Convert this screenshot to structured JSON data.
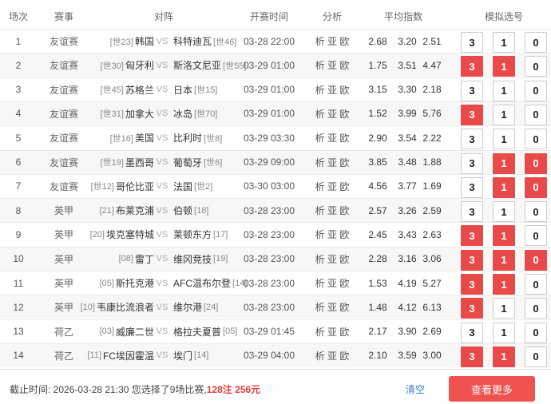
{
  "header": {
    "idx": "场次",
    "league": "赛事",
    "matchup": "对阵",
    "time": "开赛时间",
    "analysis": "分析",
    "avg_odds": "平均指数",
    "sim": "模拟选号"
  },
  "analysis_links": [
    "析",
    "亚",
    "欧"
  ],
  "vs": "VS",
  "rows": [
    {
      "idx": "1",
      "league": "友谊赛",
      "home_rank": "[世23]",
      "home": "韩国",
      "away": "科特迪瓦",
      "away_rank": "[世46]",
      "time": "03-28 22:00",
      "o1": "2.68",
      "o2": "3.20",
      "o3": "2.51",
      "sel": [
        false,
        false,
        false
      ]
    },
    {
      "idx": "2",
      "league": "友谊赛",
      "home_rank": "[世30]",
      "home": "匈牙利",
      "away": "斯洛文尼亚",
      "away_rank": "[世55]",
      "time": "03-29 01:00",
      "o1": "1.75",
      "o2": "3.51",
      "o3": "4.47",
      "sel": [
        true,
        true,
        false
      ]
    },
    {
      "idx": "3",
      "league": "友谊赛",
      "home_rank": "[世45]",
      "home": "苏格兰",
      "away": "日本",
      "away_rank": "[世15]",
      "time": "03-29 01:00",
      "o1": "3.15",
      "o2": "3.30",
      "o3": "2.18",
      "sel": [
        false,
        false,
        false
      ]
    },
    {
      "idx": "4",
      "league": "友谊赛",
      "home_rank": "[世31]",
      "home": "加拿大",
      "away": "冰岛",
      "away_rank": "[世70]",
      "time": "03-29 01:00",
      "o1": "1.52",
      "o2": "3.99",
      "o3": "5.76",
      "sel": [
        true,
        false,
        false
      ]
    },
    {
      "idx": "5",
      "league": "友谊赛",
      "home_rank": "[世16]",
      "home": "美国",
      "away": "比利时",
      "away_rank": "[世8]",
      "time": "03-29 03:30",
      "o1": "2.90",
      "o2": "3.54",
      "o3": "2.22",
      "sel": [
        false,
        false,
        false
      ]
    },
    {
      "idx": "6",
      "league": "友谊赛",
      "home_rank": "[世19]",
      "home": "墨西哥",
      "away": "葡萄牙",
      "away_rank": "[世6]",
      "time": "03-29 09:00",
      "o1": "3.85",
      "o2": "3.48",
      "o3": "1.88",
      "sel": [
        false,
        true,
        true
      ]
    },
    {
      "idx": "7",
      "league": "友谊赛",
      "home_rank": "[世12]",
      "home": "哥伦比亚",
      "away": "法国",
      "away_rank": "[世2]",
      "time": "03-30 03:00",
      "o1": "4.56",
      "o2": "3.77",
      "o3": "1.69",
      "sel": [
        false,
        true,
        true
      ]
    },
    {
      "idx": "8",
      "league": "英甲",
      "home_rank": "[21]",
      "home": "布莱克浦",
      "away": "伯顿",
      "away_rank": "[18]",
      "time": "03-28 23:00",
      "o1": "2.57",
      "o2": "3.26",
      "o3": "2.59",
      "sel": [
        false,
        false,
        false
      ]
    },
    {
      "idx": "9",
      "league": "英甲",
      "home_rank": "[20]",
      "home": "埃克塞特城",
      "away": "莱顿东方",
      "away_rank": "[17]",
      "time": "03-28 23:00",
      "o1": "2.45",
      "o2": "3.43",
      "o3": "2.63",
      "sel": [
        true,
        true,
        false
      ]
    },
    {
      "idx": "10",
      "league": "英甲",
      "home_rank": "[08]",
      "home": "雷丁",
      "away": "维冈竞技",
      "away_rank": "[19]",
      "time": "03-28 23:00",
      "o1": "2.28",
      "o2": "3.16",
      "o3": "3.06",
      "sel": [
        true,
        true,
        true
      ]
    },
    {
      "idx": "11",
      "league": "英甲",
      "home_rank": "[05]",
      "home": "斯托克港",
      "away": "AFC温布尔登",
      "away_rank": "[14]",
      "time": "03-28 23:00",
      "o1": "1.53",
      "o2": "4.19",
      "o3": "5.27",
      "sel": [
        true,
        true,
        false
      ]
    },
    {
      "idx": "12",
      "league": "英甲",
      "home_rank": "[10]",
      "home": "韦康比流浪者",
      "away": "维尔港",
      "away_rank": "[24]",
      "time": "03-28 23:00",
      "o1": "1.48",
      "o2": "4.12",
      "o3": "6.13",
      "sel": [
        true,
        false,
        false
      ]
    },
    {
      "idx": "13",
      "league": "荷乙",
      "home_rank": "[03]",
      "home": "威廉二世",
      "away": "格拉夫夏普",
      "away_rank": "[05]",
      "time": "03-29 01:45",
      "o1": "2.17",
      "o2": "3.90",
      "o3": "2.69",
      "sel": [
        false,
        false,
        false
      ]
    },
    {
      "idx": "14",
      "league": "荷乙",
      "home_rank": "[11]",
      "home": "FC埃因霍温",
      "away": "埃门",
      "away_rank": "[14]",
      "time": "03-29 04:00",
      "o1": "2.10",
      "o2": "3.59",
      "o3": "3.00",
      "sel": [
        true,
        true,
        false
      ]
    }
  ],
  "pick_labels": [
    "3",
    "1",
    "0"
  ],
  "footer": {
    "deadline_prefix": "截止时间: 2026-03-28 21:30 您选择了9场比赛,",
    "bets": "128注",
    "amount": "256元",
    "clear": "清空",
    "more": "查看更多"
  },
  "colors": {
    "accent": "#e84a4a",
    "button": "#ef5350",
    "link": "#3a7bd5"
  }
}
